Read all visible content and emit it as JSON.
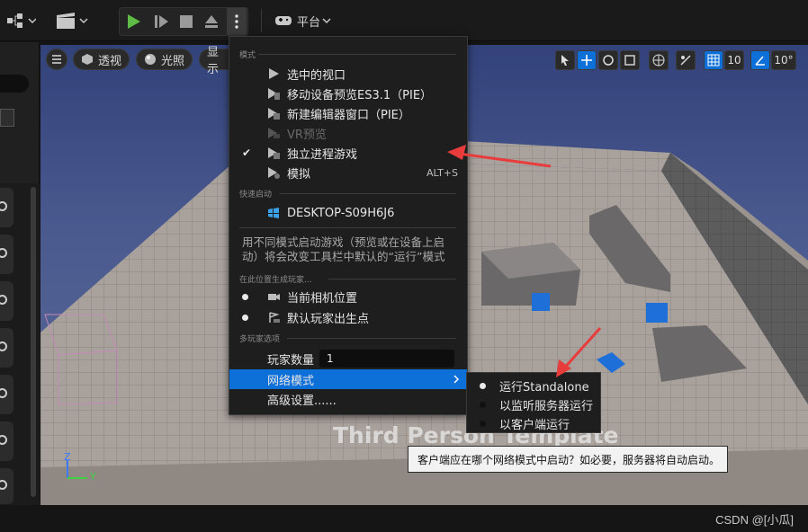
{
  "toolbar": {
    "platform_label": "平台"
  },
  "viewport_bar": {
    "perspective": "透视",
    "lighting": "光照",
    "show": "显示",
    "grid_snap_value": "10",
    "angle_snap_value": "10°"
  },
  "menu": {
    "section_mode": "模式",
    "modes": [
      {
        "label": "选中的视口",
        "checked": false,
        "disabled": false
      },
      {
        "label": "移动设备预览ES3.1（PIE）",
        "checked": false,
        "disabled": false
      },
      {
        "label": "新建编辑器窗口（PIE）",
        "checked": false,
        "disabled": false
      },
      {
        "label": "VR预览",
        "checked": false,
        "disabled": true
      },
      {
        "label": "独立进程游戏",
        "checked": true,
        "disabled": false
      },
      {
        "label": "模拟",
        "checked": false,
        "disabled": false,
        "shortcut": "ALT+S"
      }
    ],
    "section_quick": "快速启动",
    "device": "DESKTOP-S09H6J6",
    "description": "用不同模式启动游戏（预览或在设备上启动）将会改变工具栏中默认的“运行”模式",
    "section_spawn": "在此位置生成玩家...",
    "spawn": [
      "当前相机位置",
      "默认玩家出生点"
    ],
    "section_multi": "多玩家选项",
    "players_label": "玩家数量",
    "players_value": "1",
    "net_mode_label": "网络模式",
    "advanced_label": "高级设置......"
  },
  "submenu": {
    "items": [
      "运行Standalone",
      "以监听服务器运行",
      "以客户端运行"
    ]
  },
  "tooltip": "客户端应在哪个网络模式中启动？如必要，服务器将自动启动。",
  "viewport_text": "Third Person Template",
  "axis": {
    "z": "Z",
    "y": "Y"
  },
  "watermark": "CSDN @[小瓜]",
  "colors": {
    "accent": "#0d6fd8",
    "play_green": "#5dbb46",
    "arrow_red": "#e83c3c"
  }
}
